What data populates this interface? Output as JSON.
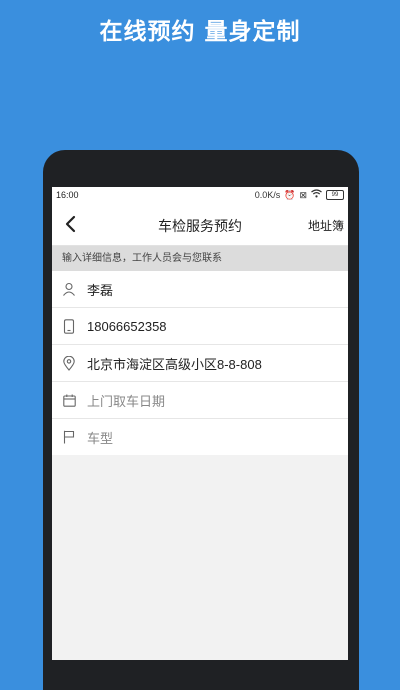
{
  "promo": {
    "title": "在线预约 量身定制"
  },
  "status_bar": {
    "time": "16:00",
    "speed": "0.0K/s",
    "battery": "99"
  },
  "nav": {
    "title": "车检服务预约",
    "right_label": "地址簿"
  },
  "hint": "输入详细信息，工作人员会与您联系",
  "form": {
    "name": "李磊",
    "phone": "18066652358",
    "address": "北京市海淀区高级小区8-8-808",
    "date_placeholder": "上门取车日期",
    "car_placeholder": "车型"
  },
  "colors": {
    "background": "#3a8fde",
    "screen_bg": "#f2f2f2",
    "hint_bg": "#dcdcdc"
  },
  "icons": [
    "back-arrow-icon",
    "person-icon",
    "phone-icon",
    "location-pin-icon",
    "calendar-icon",
    "flag-icon"
  ]
}
